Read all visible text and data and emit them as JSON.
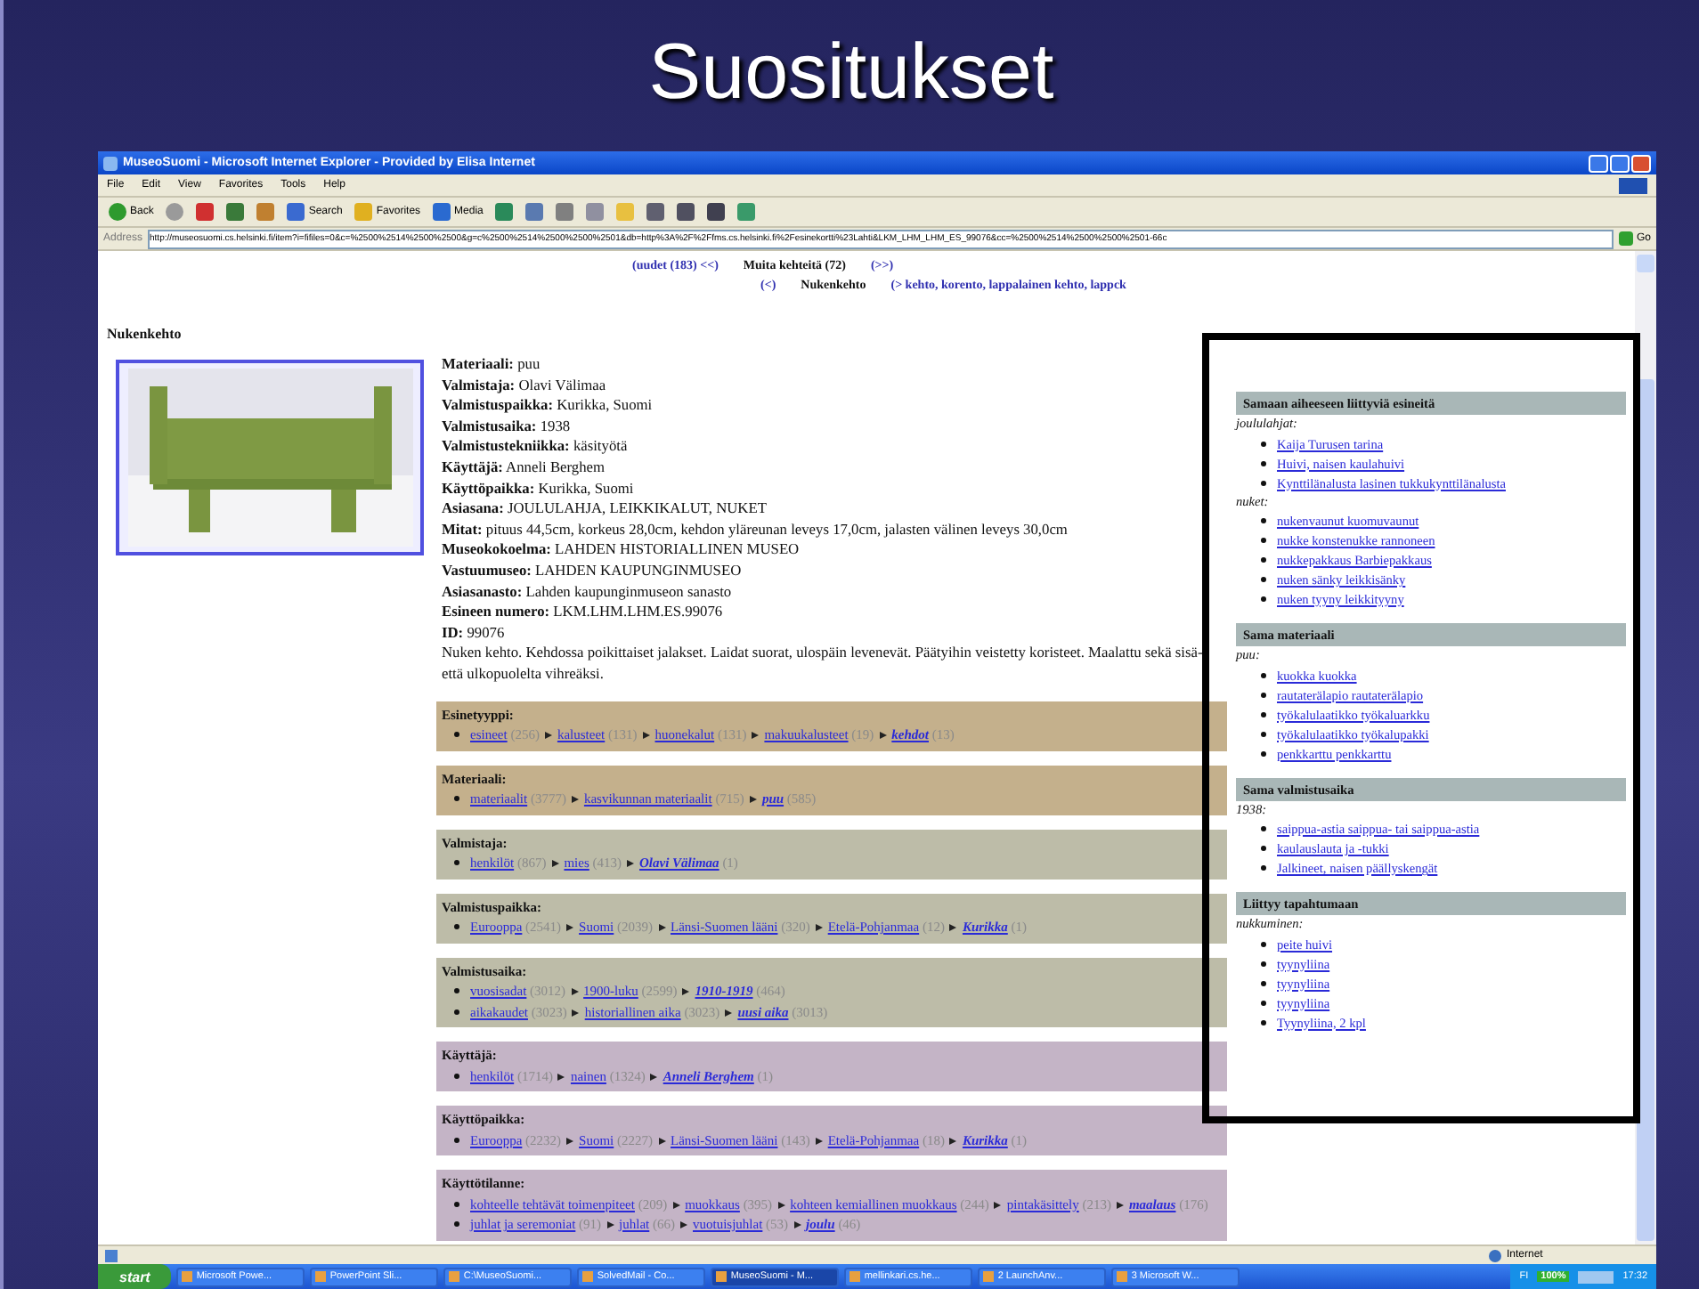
{
  "slide": {
    "title": "Suositukset"
  },
  "browser": {
    "title": "MuseoSuomi - Microsoft Internet Explorer - Provided by Elisa Internet",
    "menu": [
      "File",
      "Edit",
      "View",
      "Favorites",
      "Tools",
      "Help"
    ],
    "toolbar": [
      {
        "kind": "back",
        "label": "Back"
      },
      {
        "kind": "forward"
      },
      {
        "kind": "stop"
      },
      {
        "kind": "refresh"
      },
      {
        "kind": "home"
      },
      {
        "kind": "search",
        "label": "Search"
      },
      {
        "kind": "favorites",
        "label": "Favorites"
      },
      {
        "kind": "media",
        "label": "Media"
      },
      {
        "kind": "history"
      },
      {
        "kind": "mail"
      },
      {
        "kind": "print"
      },
      {
        "kind": "edit"
      },
      {
        "kind": "folder"
      },
      {
        "kind": "globe"
      },
      {
        "kind": "messenger"
      },
      {
        "kind": "help"
      },
      {
        "kind": "tool"
      }
    ],
    "address_label": "Address",
    "url": "http://museosuomi.cs.helsinki.fi/item?i=fifiles=0&c=%2500%2514%2500%2500&g=c%2500%2514%2500%2500%2501&db=http%3A%2F%2Ffms.cs.helsinki.fi%2Fesinekortti%23Lahti&LKM_LHM_LHM_ES_99076&cc=%2500%2514%2500%2500%2501-66c",
    "go": "Go"
  },
  "nav": [
    [
      {
        "kind": "link",
        "text": "(uudet (183) <<)"
      },
      {
        "kind": "label",
        "text": "Muita kehteitä (72)"
      },
      {
        "kind": "link",
        "text": "(>>)"
      }
    ],
    [
      {
        "kind": "link",
        "text": "(<)"
      },
      {
        "kind": "label",
        "text": "Nukenkehto"
      },
      {
        "kind": "link",
        "text": "(> kehto, korento, lappalainen kehto, lappck"
      }
    ]
  ],
  "item": {
    "heading": "Nukenkehto",
    "properties": [
      {
        "label": "Materiaali:",
        "value": "puu"
      },
      {
        "label": "Valmistaja:",
        "value": "Olavi Välimaa"
      },
      {
        "label": "Valmistuspaikka:",
        "value": "Kurikka, Suomi"
      },
      {
        "label": "Valmistusaika:",
        "value": "1938"
      },
      {
        "label": "Valmistustekniikka:",
        "value": "käsityötä"
      },
      {
        "label": "Käyttäjä:",
        "value": "Anneli Berghem"
      },
      {
        "label": "Käyttöpaikka:",
        "value": "Kurikka, Suomi"
      },
      {
        "label": "Asiasana:",
        "value": "JOULULAHJA, LEIKKIKALUT, NUKET"
      },
      {
        "label": "Mitat:",
        "value": "pituus 44,5cm, korkeus 28,0cm, kehdon yläreunan leveys 17,0cm, jalasten välinen leveys 30,0cm"
      },
      {
        "label": "Museokokoelma:",
        "value": "LAHDEN HISTORIALLINEN MUSEO"
      },
      {
        "label": "Vastuumuseo:",
        "value": "LAHDEN KAUPUNGINMUSEO"
      },
      {
        "label": "Asiasanasto:",
        "value": "Lahden kaupunginmuseon sanasto"
      },
      {
        "label": "Esineen numero:",
        "value": "LKM.LHM.LHM.ES.99076"
      },
      {
        "label": "ID:",
        "value": "99076"
      }
    ],
    "description": "Nuken kehto. Kehdossa poikittaiset jalakset. Laidat suorat, ulospäin levenevät. Päätyihin veistetty koristeet. Maalattu sekä sisä- että ulkopuolelta vihreäksi."
  },
  "categories": [
    {
      "label": "Esinetyyppi:",
      "color": "#c4b08c",
      "paths": [
        [
          {
            "text": "esineet",
            "count": "(256)"
          },
          {
            "text": "kalusteet",
            "count": "(131)"
          },
          {
            "text": "huonekalut",
            "count": "(131)"
          },
          {
            "text": "makuukalusteet",
            "count": "(19)"
          },
          {
            "text": "kehdot",
            "count": "(13)"
          }
        ]
      ]
    },
    {
      "label": "Materiaali:",
      "color": "#c4b08c",
      "paths": [
        [
          {
            "text": "materiaalit",
            "count": "(3777)"
          },
          {
            "text": "kasvikunnan materiaalit",
            "count": "(715)"
          },
          {
            "text": "puu",
            "count": "(585)"
          }
        ]
      ]
    },
    {
      "label": "Valmistaja:",
      "color": "#bdbca8",
      "paths": [
        [
          {
            "text": "henkilöt",
            "count": "(867)"
          },
          {
            "text": "mies",
            "count": "(413)"
          },
          {
            "text": "Olavi Välimaa",
            "count": "(1)"
          }
        ]
      ]
    },
    {
      "label": "Valmistuspaikka:",
      "color": "#bdbca8",
      "paths": [
        [
          {
            "text": "Eurooppa",
            "count": "(2541)"
          },
          {
            "text": "Suomi",
            "count": "(2039)"
          },
          {
            "text": "Länsi-Suomen lääni",
            "count": "(320)"
          },
          {
            "text": "Etelä-Pohjanmaa",
            "count": "(12)"
          },
          {
            "text": "Kurikka",
            "count": "(1)"
          }
        ]
      ]
    },
    {
      "label": "Valmistusaika:",
      "color": "#bdbca8",
      "paths": [
        [
          {
            "text": "vuosisadat",
            "count": "(3012)"
          },
          {
            "text": "1900-luku",
            "count": "(2599)"
          },
          {
            "text": "1910-1919",
            "count": "(464)"
          }
        ],
        [
          {
            "text": "aikakaudet",
            "count": "(3023)"
          },
          {
            "text": "historiallinen aika",
            "count": "(3023)"
          },
          {
            "text": "uusi aika",
            "count": "(3013)"
          }
        ]
      ]
    },
    {
      "label": "Käyttäjä:",
      "color": "#c4b4c6",
      "paths": [
        [
          {
            "text": "henkilöt",
            "count": "(1714)"
          },
          {
            "text": "nainen",
            "count": "(1324)"
          },
          {
            "text": "Anneli Berghem",
            "count": "(1)"
          }
        ]
      ]
    },
    {
      "label": "Käyttöpaikka:",
      "color": "#c4b4c6",
      "paths": [
        [
          {
            "text": "Eurooppa",
            "count": "(2232)"
          },
          {
            "text": "Suomi",
            "count": "(2227)"
          },
          {
            "text": "Länsi-Suomen lääni",
            "count": "(143)"
          },
          {
            "text": "Etelä-Pohjanmaa",
            "count": "(18)"
          },
          {
            "text": "Kurikka",
            "count": "(1)"
          }
        ]
      ]
    },
    {
      "label": "Käyttötilanne:",
      "color": "#c4b4c6",
      "paths": [
        [
          {
            "text": "kohteelle tehtävät toimenpiteet",
            "count": "(209)"
          },
          {
            "text": "muokkaus",
            "count": "(395)"
          },
          {
            "text": "kohteen kemiallinen muokkaus",
            "count": "(244)"
          },
          {
            "text": "pintakäsittely",
            "count": "(213)"
          },
          {
            "text": "maalaus",
            "count": "(176)"
          }
        ],
        [
          {
            "text": "juhlat ja seremoniat",
            "count": "(91)"
          },
          {
            "text": "juhlat",
            "count": "(66)"
          },
          {
            "text": "vuotuisjuhlat",
            "count": "(53)"
          },
          {
            "text": "joulu",
            "count": "(46)"
          }
        ]
      ]
    }
  ],
  "related": [
    {
      "heading": "Samaan aiheeseen liittyviä esineitä",
      "groups": [
        {
          "label": "joululahjat:",
          "items": [
            "Kaija Turusen tarina",
            "Huivi, naisen kaulahuivi",
            "Kynttilänalusta lasinen tukkukynttilänalusta"
          ]
        },
        {
          "label": "nuket:",
          "items": [
            "nukenvaunut kuomuvaunut",
            "nukke konstenukke rannoneen",
            "nukkepakkaus Barbiepakkaus",
            "nuken sänky leikkisänky",
            "nuken tyyny leikkityyny"
          ]
        }
      ]
    },
    {
      "heading": "Sama materiaali",
      "groups": [
        {
          "label": "puu:",
          "items": [
            "kuokka kuokka",
            "rautaterälapio rautaterälapio",
            "työkalulaatikko työkaluarkku",
            "työkalulaatikko työkalupakki",
            "penkkarttu penkkarttu"
          ]
        }
      ]
    },
    {
      "heading": "Sama valmistusaika",
      "groups": [
        {
          "label": "1938:",
          "items": [
            "saippua-astia saippua- tai saippua-astia",
            "kaulauslauta ja -tukki",
            "Jalkineet, naisen päällyskengät"
          ]
        }
      ]
    },
    {
      "heading": "Liittyy tapahtumaan",
      "groups": [
        {
          "label": "nukkuminen:",
          "items": [
            "peite huivi",
            "tyynyliina",
            "tyynyliina",
            "tyynyliina",
            "Tyynyliina, 2 kpl"
          ]
        }
      ]
    }
  ],
  "status_bar": {
    "zone": "Internet"
  },
  "taskbar": {
    "start": "start",
    "tasks": [
      {
        "label": "Microsoft Powe...",
        "selected": false
      },
      {
        "label": "PowerPoint Sli...",
        "selected": false
      },
      {
        "label": "C:\\MuseoSuomi...",
        "selected": false
      },
      {
        "label": "SolvedMail - Co...",
        "selected": false
      },
      {
        "label": "MuseoSuomi - M...",
        "selected": true
      },
      {
        "label": "mellinkari.cs.he...",
        "selected": false
      },
      {
        "label": "2 LaunchAnv...",
        "selected": false
      },
      {
        "label": "3 Microsoft W...",
        "selected": false
      }
    ],
    "language": "FI",
    "zoom": "100%",
    "clock": "17:32"
  }
}
